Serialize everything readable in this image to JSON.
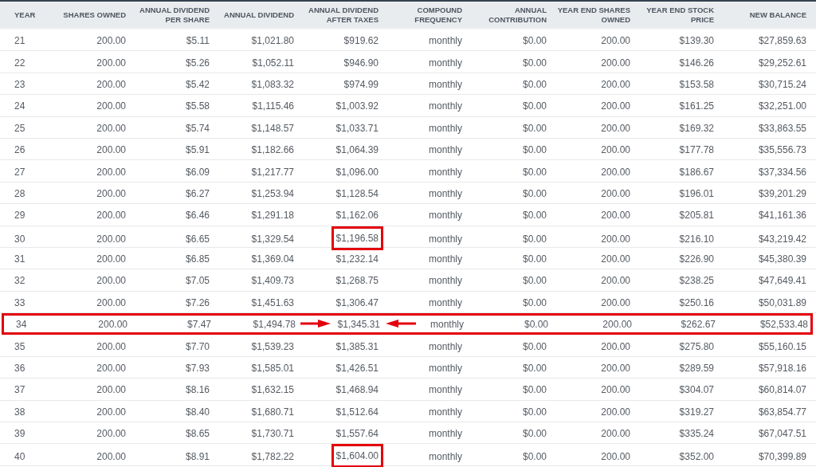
{
  "table": {
    "columns": [
      "YEAR",
      "SHARES OWNED",
      "ANNUAL DIVIDEND PER SHARE",
      "ANNUAL DIVIDEND",
      "ANNUAL DIVIDEND AFTER TAXES",
      "COMPOUND FREQUENCY",
      "ANNUAL CONTRIBUTION",
      "YEAR END SHARES OWNED",
      "YEAR END STOCK PRICE",
      "NEW BALANCE"
    ],
    "rows": [
      {
        "cells": [
          "21",
          "200.00",
          "$5.11",
          "$1,021.80",
          "$919.62",
          "monthly",
          "$0.00",
          "200.00",
          "$139.30",
          "$27,859.63"
        ],
        "highlighted": false,
        "boxed": false
      },
      {
        "cells": [
          "22",
          "200.00",
          "$5.26",
          "$1,052.11",
          "$946.90",
          "monthly",
          "$0.00",
          "200.00",
          "$146.26",
          "$29,252.61"
        ],
        "highlighted": false,
        "boxed": false
      },
      {
        "cells": [
          "23",
          "200.00",
          "$5.42",
          "$1,083.32",
          "$974.99",
          "monthly",
          "$0.00",
          "200.00",
          "$153.58",
          "$30,715.24"
        ],
        "highlighted": false,
        "boxed": false
      },
      {
        "cells": [
          "24",
          "200.00",
          "$5.58",
          "$1,115.46",
          "$1,003.92",
          "monthly",
          "$0.00",
          "200.00",
          "$161.25",
          "$32,251.00"
        ],
        "highlighted": false,
        "boxed": false
      },
      {
        "cells": [
          "25",
          "200.00",
          "$5.74",
          "$1,148.57",
          "$1,033.71",
          "monthly",
          "$0.00",
          "200.00",
          "$169.32",
          "$33,863.55"
        ],
        "highlighted": false,
        "boxed": false
      },
      {
        "cells": [
          "26",
          "200.00",
          "$5.91",
          "$1,182.66",
          "$1,064.39",
          "monthly",
          "$0.00",
          "200.00",
          "$177.78",
          "$35,556.73"
        ],
        "highlighted": false,
        "boxed": false
      },
      {
        "cells": [
          "27",
          "200.00",
          "$6.09",
          "$1,217.77",
          "$1,096.00",
          "monthly",
          "$0.00",
          "200.00",
          "$186.67",
          "$37,334.56"
        ],
        "highlighted": false,
        "boxed": false
      },
      {
        "cells": [
          "28",
          "200.00",
          "$6.27",
          "$1,253.94",
          "$1,128.54",
          "monthly",
          "$0.00",
          "200.00",
          "$196.01",
          "$39,201.29"
        ],
        "highlighted": false,
        "boxed": false
      },
      {
        "cells": [
          "29",
          "200.00",
          "$6.46",
          "$1,291.18",
          "$1,162.06",
          "monthly",
          "$0.00",
          "200.00",
          "$205.81",
          "$41,161.36"
        ],
        "highlighted": false,
        "boxed": false
      },
      {
        "cells": [
          "30",
          "200.00",
          "$6.65",
          "$1,329.54",
          "$1,196.58",
          "monthly",
          "$0.00",
          "200.00",
          "$216.10",
          "$43,219.42"
        ],
        "highlighted": false,
        "boxed": true
      },
      {
        "cells": [
          "31",
          "200.00",
          "$6.85",
          "$1,369.04",
          "$1,232.14",
          "monthly",
          "$0.00",
          "200.00",
          "$226.90",
          "$45,380.39"
        ],
        "highlighted": false,
        "boxed": false
      },
      {
        "cells": [
          "32",
          "200.00",
          "$7.05",
          "$1,409.73",
          "$1,268.75",
          "monthly",
          "$0.00",
          "200.00",
          "$238.25",
          "$47,649.41"
        ],
        "highlighted": false,
        "boxed": false
      },
      {
        "cells": [
          "33",
          "200.00",
          "$7.26",
          "$1,451.63",
          "$1,306.47",
          "monthly",
          "$0.00",
          "200.00",
          "$250.16",
          "$50,031.89"
        ],
        "highlighted": false,
        "boxed": false
      },
      {
        "cells": [
          "34",
          "200.00",
          "$7.47",
          "$1,494.78",
          "$1,345.31",
          "monthly",
          "$0.00",
          "200.00",
          "$262.67",
          "$52,533.48"
        ],
        "highlighted": true,
        "boxed": false
      },
      {
        "cells": [
          "35",
          "200.00",
          "$7.70",
          "$1,539.23",
          "$1,385.31",
          "monthly",
          "$0.00",
          "200.00",
          "$275.80",
          "$55,160.15"
        ],
        "highlighted": false,
        "boxed": false
      },
      {
        "cells": [
          "36",
          "200.00",
          "$7.93",
          "$1,585.01",
          "$1,426.51",
          "monthly",
          "$0.00",
          "200.00",
          "$289.59",
          "$57,918.16"
        ],
        "highlighted": false,
        "boxed": false
      },
      {
        "cells": [
          "37",
          "200.00",
          "$8.16",
          "$1,632.15",
          "$1,468.94",
          "monthly",
          "$0.00",
          "200.00",
          "$304.07",
          "$60,814.07"
        ],
        "highlighted": false,
        "boxed": false
      },
      {
        "cells": [
          "38",
          "200.00",
          "$8.40",
          "$1,680.71",
          "$1,512.64",
          "monthly",
          "$0.00",
          "200.00",
          "$319.27",
          "$63,854.77"
        ],
        "highlighted": false,
        "boxed": false
      },
      {
        "cells": [
          "39",
          "200.00",
          "$8.65",
          "$1,730.71",
          "$1,557.64",
          "monthly",
          "$0.00",
          "200.00",
          "$335.24",
          "$67,047.51"
        ],
        "highlighted": false,
        "boxed": false
      },
      {
        "cells": [
          "40",
          "200.00",
          "$8.91",
          "$1,782.22",
          "$1,604.00",
          "monthly",
          "$0.00",
          "200.00",
          "$352.00",
          "$70,399.89"
        ],
        "highlighted": false,
        "boxed": true
      }
    ]
  }
}
